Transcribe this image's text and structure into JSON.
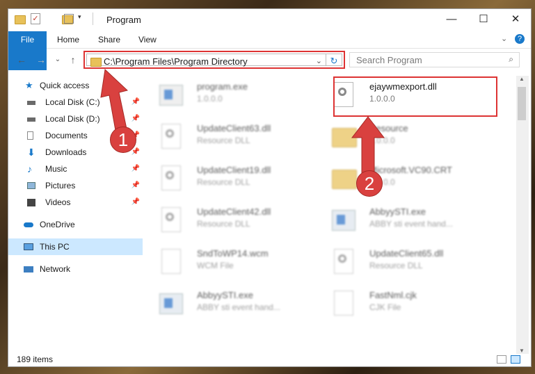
{
  "window": {
    "title": "Program"
  },
  "ribbon": {
    "tabs": [
      "File",
      "Home",
      "Share",
      "View"
    ]
  },
  "address": {
    "path": "C:\\Program Files\\Program Directory"
  },
  "search": {
    "placeholder": "Search Program"
  },
  "nav": {
    "quick_access": "Quick access",
    "items": [
      {
        "label": "Local Disk (C:)",
        "icon": "drive-icon",
        "pinned": true
      },
      {
        "label": "Local Disk (D:)",
        "icon": "drive-icon",
        "pinned": true
      },
      {
        "label": "Documents",
        "icon": "documents-icon",
        "pinned": true
      },
      {
        "label": "Downloads",
        "icon": "downloads-icon",
        "pinned": true
      },
      {
        "label": "Music",
        "icon": "music-icon",
        "pinned": true
      },
      {
        "label": "Pictures",
        "icon": "pictures-icon",
        "pinned": true
      },
      {
        "label": "Videos",
        "icon": "videos-icon",
        "pinned": true
      }
    ],
    "onedrive": "OneDrive",
    "thispc": "This PC",
    "network": "Network"
  },
  "files": [
    {
      "name": "program.exe",
      "sub": "1.0.0.0",
      "icon": "exe-icon"
    },
    {
      "name": "ejaywmexport.dll",
      "sub": "1.0.0.0",
      "icon": "dll-icon"
    },
    {
      "name": "UpdateClient63.dll",
      "sub": "Resource DLL",
      "icon": "dll-icon"
    },
    {
      "name": "Resource",
      "sub": "1.0.0.0",
      "icon": "folder-icon"
    },
    {
      "name": "UpdateClient19.dll",
      "sub": "Resource DLL",
      "icon": "dll-icon"
    },
    {
      "name": "Microsoft.VC90.CRT",
      "sub": "1.0.0.0",
      "icon": "folder-icon"
    },
    {
      "name": "UpdateClient42.dll",
      "sub": "Resource DLL",
      "icon": "dll-icon"
    },
    {
      "name": "AbbyySTI.exe",
      "sub": "ABBY sti event hand...",
      "icon": "exe-icon"
    },
    {
      "name": "SndToWP14.wcm",
      "sub": "WCM File",
      "icon": "file-icon"
    },
    {
      "name": "UpdateClient65.dll",
      "sub": "Resource DLL",
      "icon": "dll-icon"
    },
    {
      "name": "AbbyySTI.exe",
      "sub": "ABBY sti event hand...",
      "icon": "exe-icon"
    },
    {
      "name": "FastNml.cjk",
      "sub": "CJK File",
      "icon": "file-icon"
    }
  ],
  "status": {
    "count": "189 items"
  },
  "annotations": {
    "one": "1",
    "two": "2",
    "color": "#d9413f"
  }
}
